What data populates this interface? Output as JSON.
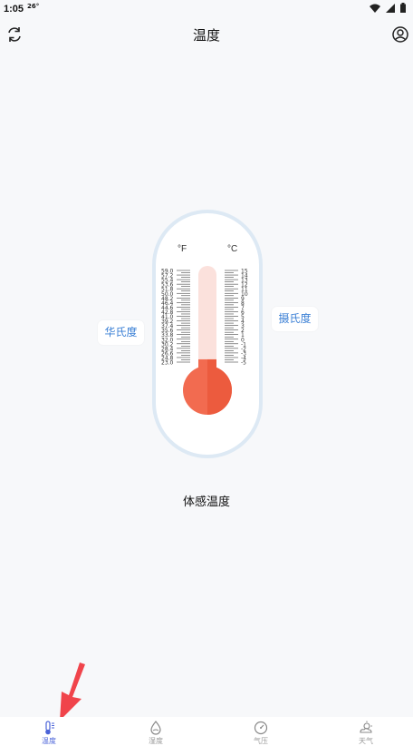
{
  "statusbar": {
    "time": "1:05",
    "temp": "26°"
  },
  "header": {
    "title": "温度"
  },
  "thermometer": {
    "unit_f": "°F",
    "unit_c": "°C",
    "f_ticks": [
      "59.0",
      "57.2",
      "55.4",
      "53.6",
      "51.8",
      "50.0",
      "48.2",
      "46.4",
      "44.6",
      "42.8",
      "41.0",
      "39.2",
      "37.4",
      "35.6",
      "33.8",
      "32.0",
      "30.2",
      "28.4",
      "26.6",
      "24.8",
      "23.0"
    ],
    "c_ticks": [
      "15",
      "14",
      "13",
      "12",
      "11",
      "10",
      "9",
      "8",
      "7",
      "6",
      "5",
      "4",
      "3",
      "2",
      "1",
      "0",
      "-1",
      "-2",
      "-3",
      "-4",
      "-5"
    ],
    "level_fraction": 0.28
  },
  "buttons": {
    "fahrenheit": "华氏度",
    "celsius": "摄氏度"
  },
  "feels_label": "体感温度",
  "tabs": [
    {
      "label": "温度",
      "icon": "thermometer-icon",
      "active": true
    },
    {
      "label": "湿度",
      "icon": "humidity-icon",
      "active": false
    },
    {
      "label": "气压",
      "icon": "pressure-gauge-icon",
      "active": false
    },
    {
      "label": "天气",
      "icon": "weather-icon",
      "active": false
    }
  ],
  "colors": {
    "accent": "#4b63d8",
    "mercury": "#f26b50",
    "annotation_arrow": "#f0444b"
  }
}
